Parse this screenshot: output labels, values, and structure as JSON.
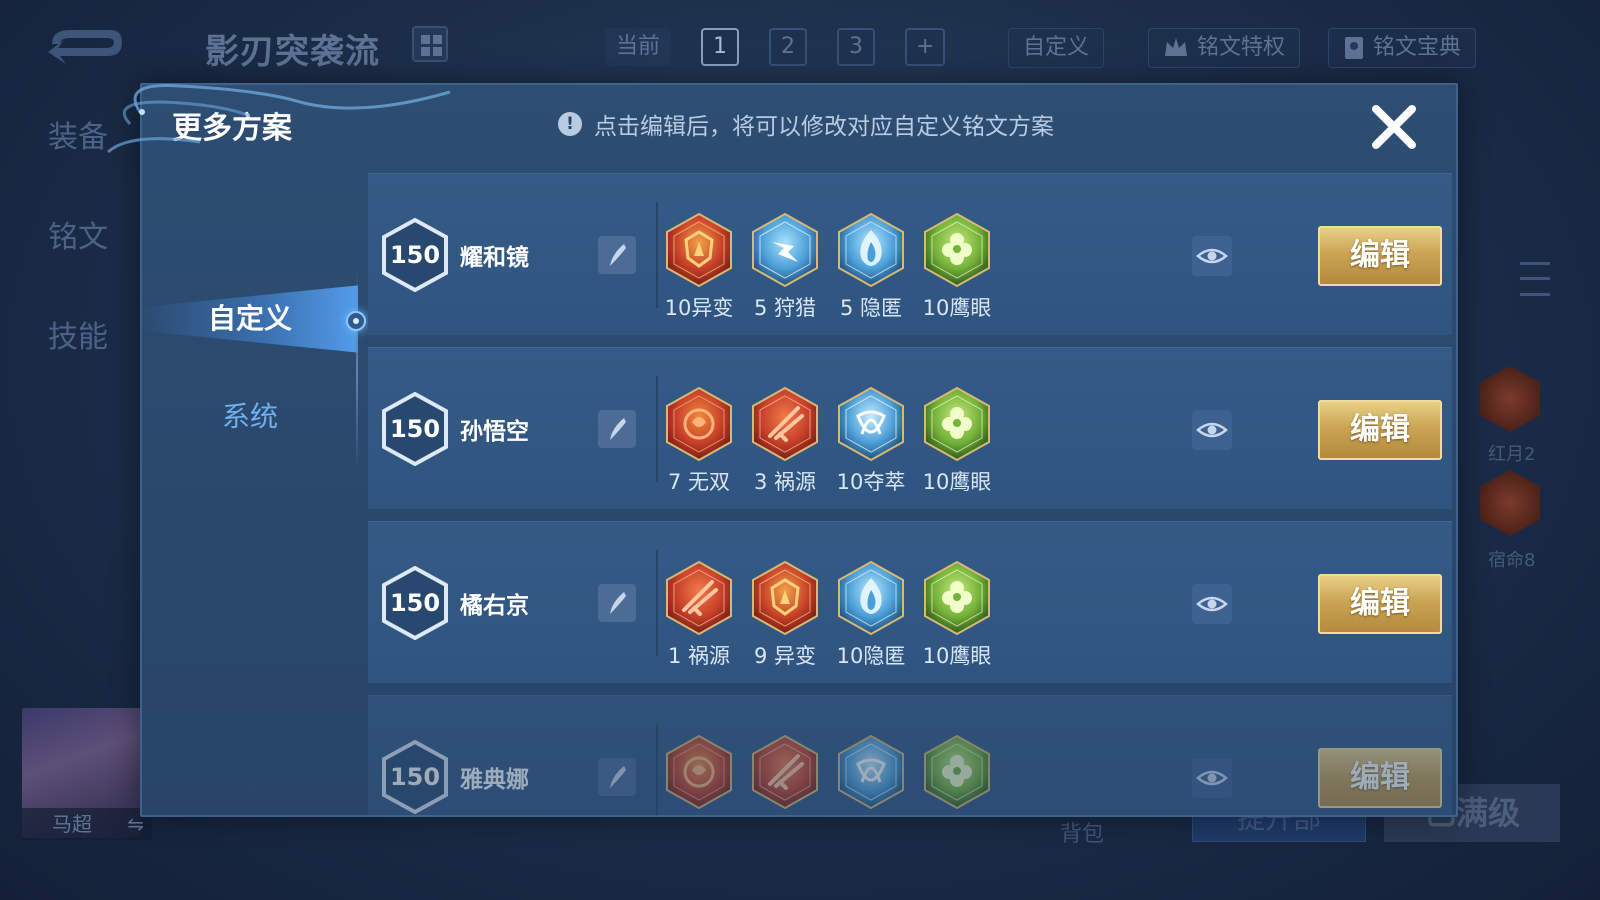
{
  "background": {
    "scheme_title": "影刃突袭流",
    "page_tabs": [
      {
        "label": "当前",
        "active": false,
        "plain": true
      },
      {
        "label": "1",
        "active": true,
        "plain": false
      },
      {
        "label": "2",
        "active": false,
        "plain": false
      },
      {
        "label": "3",
        "active": false,
        "plain": false
      },
      {
        "label": "+",
        "active": false,
        "plain": false
      }
    ],
    "custom_button": "自定义",
    "privilege_button": "铭文特权",
    "guide_button": "铭文宝典",
    "side_nav": [
      "装备",
      "铭文",
      "技能"
    ],
    "hero_name": "马超",
    "swap_glyph": "⇋",
    "right_runes": [
      {
        "label": "红月2"
      },
      {
        "label": "宿命8"
      }
    ],
    "backpack": "背包",
    "bottom_button_1": "提升部",
    "bottom_button_2": "已满级"
  },
  "modal": {
    "title": "更多方案",
    "hint": "点击编辑后，将可以修改对应自定义铭文方案",
    "hint_icon": "!",
    "close_icon": "close-icon",
    "tabs": {
      "custom": "自定义",
      "system": "系统"
    },
    "edit_label": "编辑",
    "rows": [
      {
        "level": "150",
        "name": "耀和镜",
        "runes": [
          {
            "label": "10异变",
            "kind": "red-shield"
          },
          {
            "label": "5 狩猎",
            "kind": "blue-bolt"
          },
          {
            "label": "5 隐匿",
            "kind": "blue-flame"
          },
          {
            "label": "10鹰眼",
            "kind": "green-clover"
          }
        ]
      },
      {
        "level": "150",
        "name": "孙悟空",
        "runes": [
          {
            "label": "7 无双",
            "kind": "red-rose"
          },
          {
            "label": "3 祸源",
            "kind": "red-blade"
          },
          {
            "label": "10夺萃",
            "kind": "blue-knot"
          },
          {
            "label": "10鹰眼",
            "kind": "green-clover"
          }
        ]
      },
      {
        "level": "150",
        "name": "橘右京",
        "runes": [
          {
            "label": "1 祸源",
            "kind": "red-blade"
          },
          {
            "label": "9 异变",
            "kind": "red-shield"
          },
          {
            "label": "10隐匿",
            "kind": "blue-flame"
          },
          {
            "label": "10鹰眼",
            "kind": "green-clover"
          }
        ]
      },
      {
        "level": "150",
        "name": "雅典娜",
        "runes": [
          {
            "label": "",
            "kind": "red-rose"
          },
          {
            "label": "",
            "kind": "red-blade"
          },
          {
            "label": "",
            "kind": "blue-knot"
          },
          {
            "label": "",
            "kind": "green-clover"
          }
        ]
      }
    ]
  },
  "colors": {
    "red_rune": "#c8412a",
    "blue_rune": "#4b9fd8",
    "green_rune": "#74b23a",
    "gold_button": "#c9a252"
  }
}
